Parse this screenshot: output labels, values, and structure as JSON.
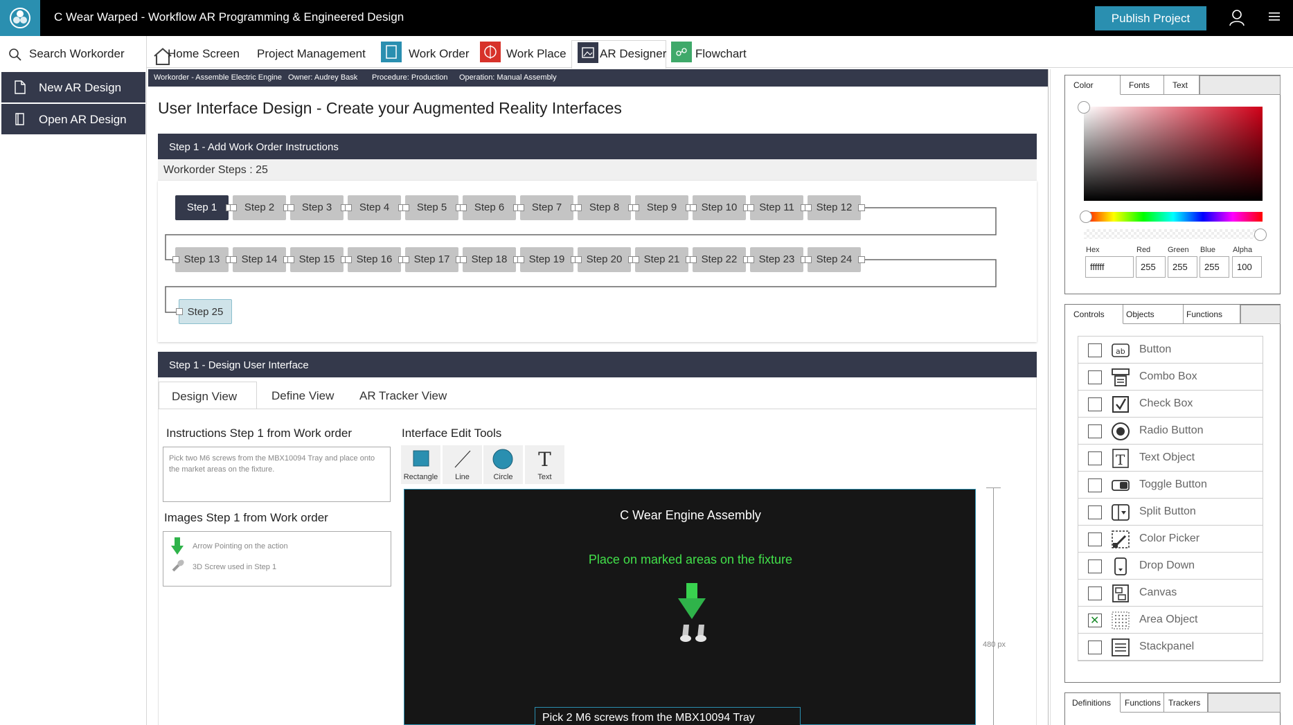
{
  "app": {
    "title": "C Wear Warped - Workflow AR Programming & Engineered Design",
    "publish_label": "Publish Project"
  },
  "sidebar": {
    "search_label": "Search Workorder",
    "items": [
      {
        "label": "New AR Design"
      },
      {
        "label": "Open AR Design"
      }
    ]
  },
  "nav": {
    "tabs": [
      {
        "label": "Home Screen"
      },
      {
        "label": "Project Management"
      },
      {
        "label": "Work Order"
      },
      {
        "label": "Work Place"
      },
      {
        "label": "AR Designer"
      },
      {
        "label": "Flowchart"
      }
    ]
  },
  "info": {
    "workorder": "Workorder - Assemble Electric Engine",
    "owner": "Owner: Audrey Bask",
    "procedure": "Procedure: Production",
    "operation": "Operation: Manual Assembly"
  },
  "page_title": "User Interface Design - Create your Augmented Reality Interfaces",
  "step_panel": {
    "header": "Step 1 - Add Work Order Instructions",
    "count_label": "Workorder Steps : 25",
    "steps": [
      "Step 1",
      "Step 2",
      "Step 3",
      "Step 4",
      "Step 5",
      "Step 6",
      "Step 7",
      "Step 8",
      "Step 9",
      "Step 10",
      "Step 11",
      "Step 12",
      "Step 13",
      "Step 14",
      "Step 15",
      "Step 16",
      "Step 17",
      "Step 18",
      "Step 19",
      "Step 20",
      "Step 21",
      "Step 22",
      "Step 23",
      "Step 24",
      "Step 25"
    ]
  },
  "design_panel": {
    "header": "Step 1 - Design User Interface",
    "tabs": [
      {
        "label": "Design View"
      },
      {
        "label": "Define View"
      },
      {
        "label": "AR Tracker View"
      }
    ],
    "instructions_label": "Instructions  Step 1 from Work order",
    "instructions_text": "Pick two M6 screws from the MBX10094 Tray and place onto the market areas on the fixture.",
    "images_label": "Images Step 1 from Work order",
    "images": [
      {
        "label": "Arrow Pointing on the action"
      },
      {
        "label": "3D Screw used in Step 1"
      }
    ],
    "tools_label": "Interface Edit Tools",
    "tools": [
      {
        "label": "Rectangle"
      },
      {
        "label": "Line"
      },
      {
        "label": "Circle"
      },
      {
        "label": "Text"
      }
    ],
    "canvas": {
      "title": "C Wear Engine Assembly",
      "subtitle": "Place on marked areas on the fixture",
      "input_text": "Pick 2 M6 screws from the MBX10094 Tray",
      "height_label": "480 px"
    }
  },
  "color_panel": {
    "tabs": [
      {
        "label": "Color"
      },
      {
        "label": "Fonts"
      },
      {
        "label": "Text"
      }
    ],
    "fields": [
      {
        "label": "Hex",
        "value": "ffffff"
      },
      {
        "label": "Red",
        "value": "255"
      },
      {
        "label": "Green",
        "value": "255"
      },
      {
        "label": "Blue",
        "value": "255"
      },
      {
        "label": "Alpha",
        "value": "100"
      }
    ]
  },
  "controls_panel": {
    "tabs": [
      {
        "label": "Controls"
      },
      {
        "label": "Objects"
      },
      {
        "label": "Functions"
      }
    ],
    "items": [
      {
        "label": "Button",
        "icon": "button-icon",
        "checked": false
      },
      {
        "label": "Combo Box",
        "icon": "combo-box-icon",
        "checked": false
      },
      {
        "label": "Check Box",
        "icon": "check-box-icon",
        "checked": false
      },
      {
        "label": "Radio Button",
        "icon": "radio-button-icon",
        "checked": false
      },
      {
        "label": "Text Object",
        "icon": "text-object-icon",
        "checked": false
      },
      {
        "label": "Toggle Button",
        "icon": "toggle-button-icon",
        "checked": false
      },
      {
        "label": "Split Button",
        "icon": "split-button-icon",
        "checked": false
      },
      {
        "label": "Color Picker",
        "icon": "color-picker-icon",
        "checked": false
      },
      {
        "label": "Drop Down",
        "icon": "drop-down-icon",
        "checked": false
      },
      {
        "label": "Canvas",
        "icon": "canvas-icon",
        "checked": false
      },
      {
        "label": "Area Object",
        "icon": "area-object-icon",
        "checked": true
      },
      {
        "label": "Stackpanel",
        "icon": "stackpanel-icon",
        "checked": false
      }
    ]
  },
  "bottom_panel": {
    "tabs": [
      {
        "label": "Definitions"
      },
      {
        "label": "Functions"
      },
      {
        "label": "Trackers"
      }
    ]
  }
}
